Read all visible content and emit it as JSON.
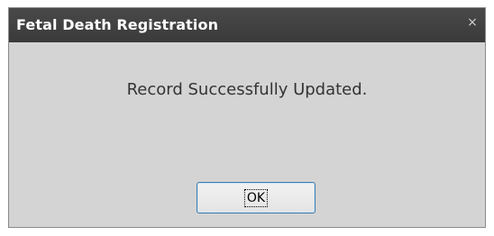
{
  "dialog": {
    "title": "Fetal Death Registration",
    "close_glyph": "×",
    "message": "Record Successfully Updated.",
    "ok_label": "OK"
  },
  "colors": {
    "titlebar": "#3f3f3f",
    "body": "#d4d4d4",
    "button_border": "#3d7bad"
  }
}
